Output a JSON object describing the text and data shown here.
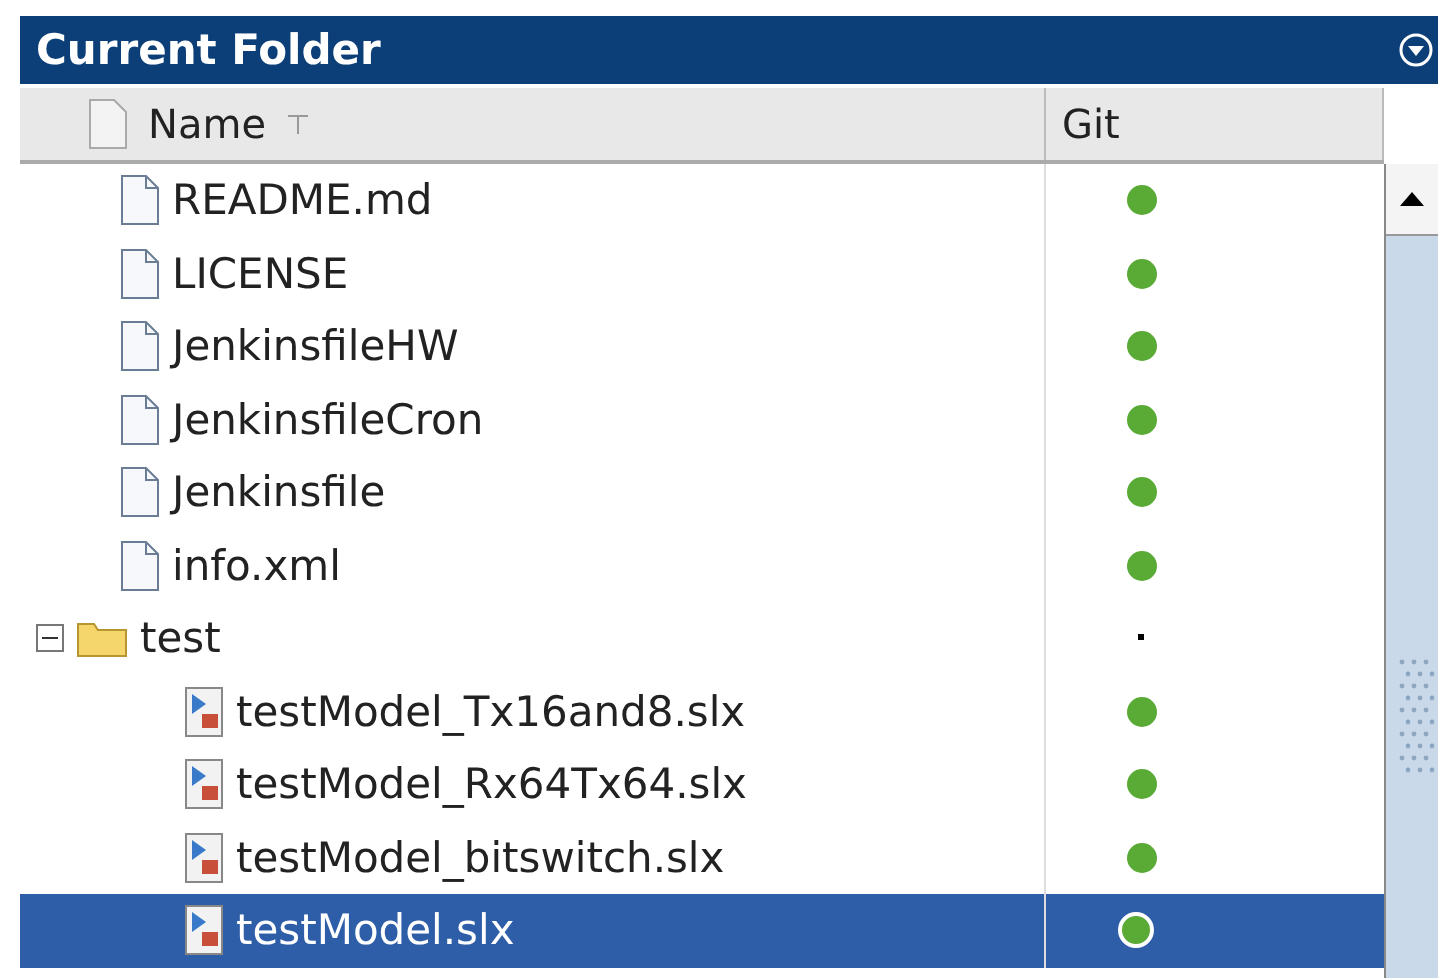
{
  "panel": {
    "title": "Current Folder"
  },
  "columns": [
    {
      "label": "Name",
      "sorted": true
    },
    {
      "label": "Git",
      "sorted": false
    }
  ],
  "items": [
    {
      "name": "README.md",
      "kind": "file",
      "git_tracked": true,
      "selected": false
    },
    {
      "name": "LICENSE",
      "kind": "file",
      "git_tracked": true,
      "selected": false
    },
    {
      "name": "JenkinsfileHW",
      "kind": "file",
      "git_tracked": true,
      "selected": false
    },
    {
      "name": "JenkinsfileCron",
      "kind": "file",
      "git_tracked": true,
      "selected": false
    },
    {
      "name": "Jenkinsfile",
      "kind": "file",
      "git_tracked": true,
      "selected": false
    },
    {
      "name": "info.xml",
      "kind": "file",
      "git_tracked": true,
      "selected": false
    },
    {
      "name": "test",
      "kind": "folder",
      "git_tracked": false,
      "selected": false,
      "expanded": true,
      "children": [
        {
          "name": "testModel_Tx16and8.slx",
          "kind": "model",
          "git_tracked": true,
          "selected": false
        },
        {
          "name": "testModel_Rx64Tx64.slx",
          "kind": "model",
          "git_tracked": true,
          "selected": false
        },
        {
          "name": "testModel_bitswitch.slx",
          "kind": "model",
          "git_tracked": true,
          "selected": false
        },
        {
          "name": "testModel.slx",
          "kind": "model",
          "git_tracked": true,
          "selected": true
        }
      ]
    }
  ]
}
